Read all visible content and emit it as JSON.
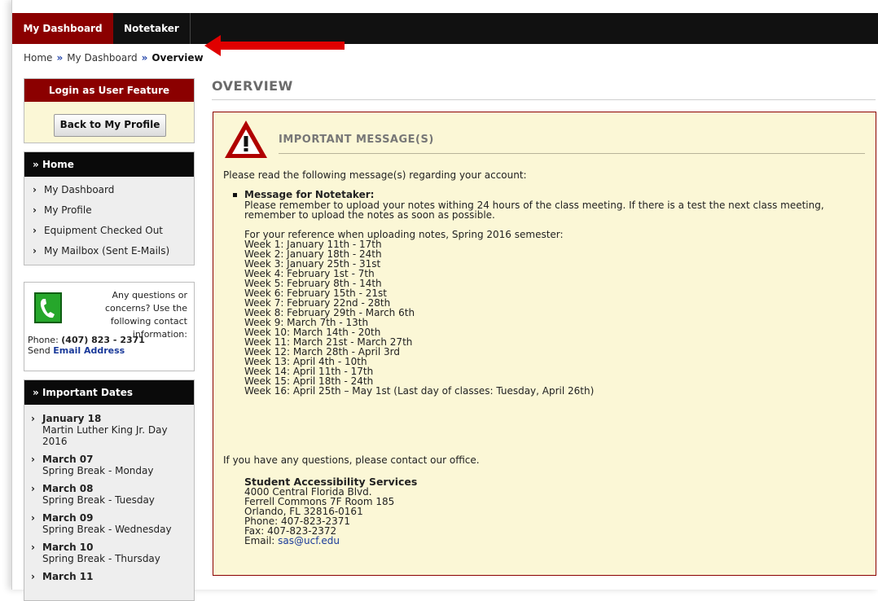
{
  "nav": {
    "dashboard": "My Dashboard",
    "notetaker": "Notetaker"
  },
  "breadcrumb": {
    "home": "Home",
    "sep": "»",
    "dashboard": "My Dashboard",
    "current": "Overview"
  },
  "login_feature": {
    "title": "Login as User Feature",
    "button": "Back to My Profile"
  },
  "home_menu": {
    "title": "Home",
    "items": [
      "My Dashboard",
      "My Profile",
      "Equipment Checked Out",
      "My Mailbox (Sent E-Mails)"
    ]
  },
  "contact": {
    "text": "Any questions or concerns? Use the following contact information:",
    "phone_label": "Phone:",
    "phone": "(407) 823 - 2371",
    "send_label": "Send",
    "email_link": "Email Address"
  },
  "dates": {
    "title": "Important Dates",
    "items": [
      {
        "date": "January 18",
        "note": "Martin Luther King Jr. Day 2016"
      },
      {
        "date": "March 07",
        "note": "Spring Break - Monday"
      },
      {
        "date": "March 08",
        "note": "Spring Break - Tuesday"
      },
      {
        "date": "March 09",
        "note": "Spring Break - Wednesday"
      },
      {
        "date": "March 10",
        "note": "Spring Break - Thursday"
      },
      {
        "date": "March 11",
        "note": ""
      }
    ]
  },
  "page": {
    "title": "OVERVIEW"
  },
  "message": {
    "title": "IMPORTANT MESSAGE(S)",
    "intro": "Please read the following message(s) regarding your account:",
    "heading": "Message for Notetaker:",
    "body": "Please remember to upload your notes withing 24 hours of the class meeting. If there is a test the next class meeting, remember to upload the notes as soon as possible.",
    "reference": "For your reference when uploading notes, Spring 2016 semester:",
    "weeks": [
      "Week 1: January 11th - 17th",
      "Week 2: January 18th - 24th",
      "Week 3: January 25th - 31st",
      "Week 4: February 1st - 7th",
      "Week 5: February 8th - 14th",
      "Week 6: February 15th - 21st",
      "Week 7: February 22nd - 28th",
      "Week 8: February 29th - March 6th",
      "Week 9: March 7th - 13th",
      "Week 10: March 14th - 20th",
      "Week 11: March 21st - March 27th",
      "Week 12: March 28th - April 3rd",
      "Week 13: April 4th - 10th",
      "Week 14: April 11th - 17th",
      "Week 15: April 18th - 24th",
      "Week 16: April 25th – May 1st (Last day of classes: Tuesday, April 26th)"
    ],
    "closing": "If you have any questions, please contact our office.",
    "office": {
      "name": "Student Accessibility Services",
      "lines": [
        "4000 Central Florida Blvd.",
        "Ferrell Commons 7F Room 185",
        "Orlando, FL 32816-0161",
        "Phone: 407-823-2371",
        "Fax: 407-823-2372"
      ],
      "email_label": "Email:",
      "email": "sas@ucf.edu"
    }
  },
  "colors": {
    "brand": "#8b0000",
    "message_bg": "#fbf7d6",
    "link": "#1a3a9a"
  }
}
